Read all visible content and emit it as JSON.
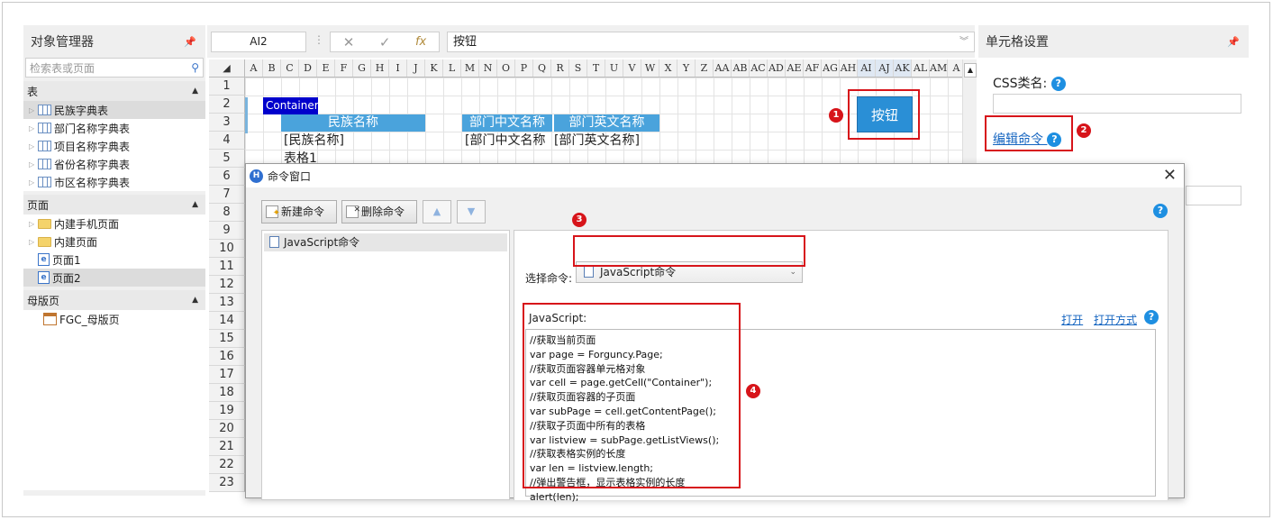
{
  "object_manager": {
    "title": "对象管理器",
    "search_placeholder": "检索表或页面",
    "sections": {
      "tables": "表",
      "pages": "页面",
      "masters": "母版页"
    },
    "tables": [
      "民族字典表",
      "部门名称字典表",
      "项目名称字典表",
      "省份名称字典表",
      "市区名称字典表"
    ],
    "pages": [
      "内建手机页面",
      "内建页面",
      "页面1",
      "页面2"
    ],
    "masters": [
      "FGC_母版页"
    ]
  },
  "formula_bar": {
    "cell_ref": "AI2",
    "content": "按钮"
  },
  "sheet": {
    "columns": [
      "A",
      "B",
      "C",
      "D",
      "E",
      "F",
      "G",
      "H",
      "I",
      "J",
      "K",
      "L",
      "M",
      "N",
      "O",
      "P",
      "Q",
      "R",
      "S",
      "T",
      "U",
      "V",
      "W",
      "X",
      "Y",
      "Z",
      "AA",
      "AB",
      "AC",
      "AD",
      "AE",
      "AF",
      "AG",
      "AH",
      "AI",
      "AJ",
      "AK",
      "AL",
      "AM",
      "A"
    ],
    "rows": [
      "1",
      "2",
      "3",
      "4",
      "5",
      "6",
      "7",
      "8",
      "9",
      "10",
      "11",
      "12",
      "13",
      "14",
      "15",
      "16",
      "17",
      "18",
      "19",
      "20",
      "21",
      "22",
      "23"
    ],
    "container_label": "Container",
    "table1_header": "民族名称",
    "table1_cell": "[民族名称]",
    "table1_name": "表格1",
    "table2_header1": "部门中文名称",
    "table2_header2": "部门英文名称",
    "table2_cell1": "[部门中文名称",
    "table2_cell2": "[部门英文名称]",
    "button_label": "按钮"
  },
  "cell_settings": {
    "title": "单元格设置",
    "css_label": "CSS类名:",
    "edit_command": "编辑命令"
  },
  "dialog": {
    "title": "命令窗口",
    "new_command": "新建命令",
    "delete_command": "删除命令",
    "command_item": "JavaScript命令",
    "select_label": "选择命令:",
    "selected_command": "JavaScript命令",
    "js_label": "JavaScript:",
    "open": "打开",
    "open_with": "打开方式",
    "code": "//获取当前页面\nvar page = Forguncy.Page;\n//获取页面容器单元格对象\nvar cell = page.getCell(\"Container\");\n//获取页面容器的子页面\nvar subPage = cell.getContentPage();\n//获取子页面中所有的表格\nvar listview = subPage.getListViews();\n//获取表格实例的长度\nvar len = listview.length;\n//弹出警告框，显示表格实例的长度\nalert(len);"
  },
  "badges": [
    "1",
    "2",
    "3",
    "4"
  ],
  "colors": {
    "accent": "#1e8fe1",
    "highlight_red": "#d7141a",
    "table_header": "#4aa3dc"
  }
}
